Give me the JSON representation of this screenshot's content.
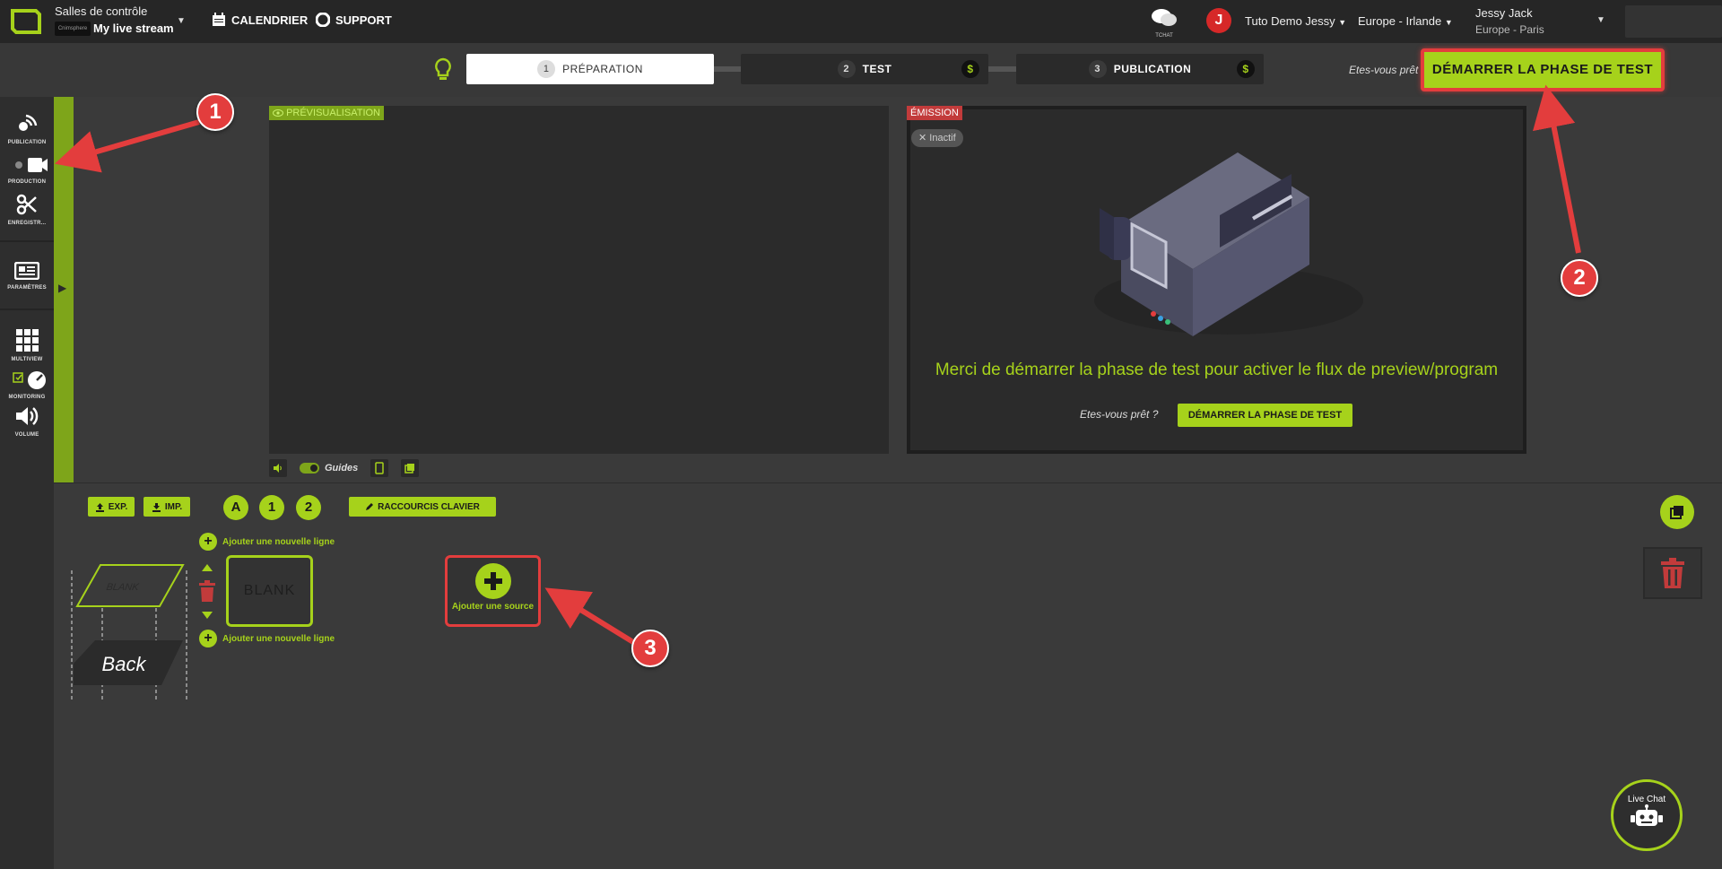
{
  "topbar": {
    "room_label": "Salles de contrôle",
    "stream_chip": "Cnimsphere",
    "stream_name": "My live stream",
    "calendar": "CALENDRIER",
    "support": "SUPPORT",
    "tchat": "TCHAT",
    "avatar_initial": "J",
    "account_name": "Tuto Demo Jessy",
    "region": "Europe - Irlande",
    "user_name": "Jessy Jack",
    "user_timezone": "Europe - Paris"
  },
  "steps": [
    {
      "num": "1",
      "label": "PRÉPARATION",
      "paid": false
    },
    {
      "num": "2",
      "label": "TEST",
      "paid": true
    },
    {
      "num": "3",
      "label": "PUBLICATION",
      "paid": true
    }
  ],
  "steps_bar": {
    "ready_label": "Etes-vous prêt ?",
    "start_test": "DÉMARRER LA PHASE DE TEST",
    "dollar": "$"
  },
  "sidebar": {
    "items": [
      {
        "label": "PUBLICATION",
        "icon": "broadcast-icon"
      },
      {
        "label": "PRODUCTION",
        "icon": "video-camera-icon"
      },
      {
        "label": "ENREGISTR...",
        "icon": "scissors-icon"
      },
      {
        "label": "PARAMÈTRES",
        "icon": "newspaper-icon"
      },
      {
        "label": "MULTIVIEW",
        "icon": "grid-icon"
      },
      {
        "label": "MONITORING",
        "icon": "gauge-icon"
      },
      {
        "label": "VOLUME",
        "icon": "speaker-icon"
      }
    ]
  },
  "preview": {
    "tag": "PRÉVISUALISATION",
    "guides": "Guides"
  },
  "emission": {
    "tag": "ÉMISSION",
    "inactive": "Inactif",
    "message": "Merci de démarrer la phase de test pour activer le flux de preview/program",
    "ready_label": "Etes-vous prêt ?",
    "start_test": "DÉMARRER LA PHASE DE TEST"
  },
  "lower": {
    "exp": "EXP.",
    "imp": "IMP.",
    "round_a": "A",
    "round_1": "1",
    "round_2": "2",
    "shortcuts": "RACCOURCIS CLAVIER",
    "add_line": "Ajouter une nouvelle ligne",
    "blank_layer": "BLANK",
    "back_layer": "Back",
    "blank_tile": "BLANK",
    "add_source": "Ajouter une source"
  },
  "live_chat": {
    "label": "Live Chat"
  },
  "annotations": [
    "1",
    "2",
    "3"
  ],
  "colors": {
    "accent": "#a6d21b",
    "accent_dark": "#7ea51a",
    "danger": "#e33d3d",
    "topbar": "#262626"
  }
}
